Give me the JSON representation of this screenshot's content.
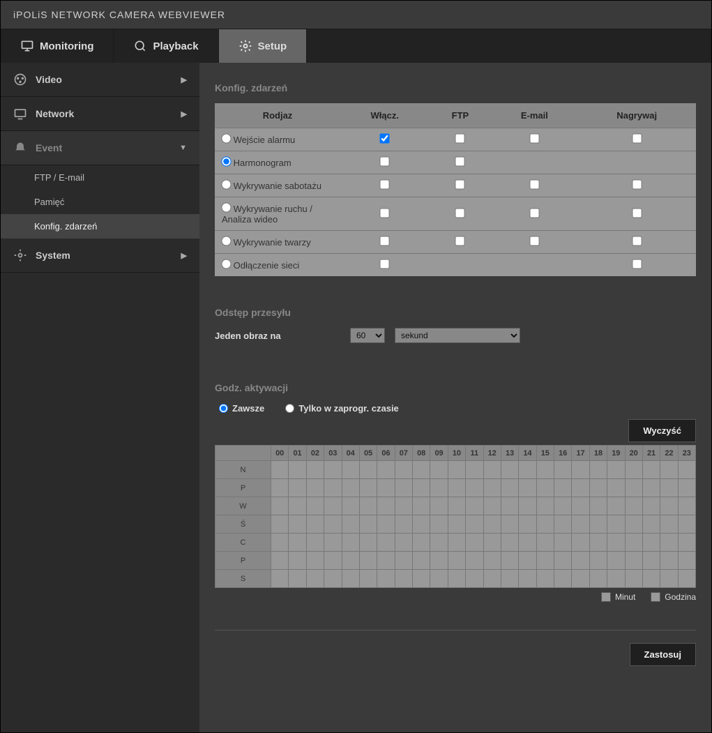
{
  "header": {
    "brand_prefix": "iPOLiS",
    "brand_rest": "NETWORK CAMERA WEBVIEWER"
  },
  "top_tabs": {
    "monitoring": "Monitoring",
    "playback": "Playback",
    "setup": "Setup"
  },
  "sidebar": {
    "video": "Video",
    "network": "Network",
    "event": "Event",
    "event_items": {
      "ftp_email": "FTP / E-mail",
      "storage": "Pamięć",
      "event_setup": "Konfig. zdarzeń"
    },
    "system": "System"
  },
  "sections": {
    "event_setup": "Konfig. zdarzeń",
    "transfer_interval": "Odstęp przesyłu",
    "activation_time": "Godz. aktywacji"
  },
  "event_table": {
    "headers": {
      "type": "Rodjaz",
      "enable": "Włącz.",
      "ftp": "FTP",
      "email": "E-mail",
      "record": "Nagrywaj"
    },
    "rows": [
      {
        "id": "alarm_in",
        "label": "Wejście alarmu",
        "selected": false,
        "enable": true,
        "ftp": false,
        "email": false,
        "record": false,
        "show_ftp": true,
        "show_email": true,
        "show_record": true
      },
      {
        "id": "schedule",
        "label": "Harmonogram",
        "selected": true,
        "enable": false,
        "ftp": false,
        "email": null,
        "record": null,
        "show_ftp": true,
        "show_email": false,
        "show_record": false
      },
      {
        "id": "tamper",
        "label": "Wykrywanie sabotażu",
        "selected": false,
        "enable": false,
        "ftp": false,
        "email": false,
        "record": false,
        "show_ftp": true,
        "show_email": true,
        "show_record": true
      },
      {
        "id": "motion",
        "label": "Wykrywanie ruchu / Analiza wideo",
        "selected": false,
        "enable": false,
        "ftp": false,
        "email": false,
        "record": false,
        "show_ftp": true,
        "show_email": true,
        "show_record": true
      },
      {
        "id": "face",
        "label": "Wykrywanie twarzy",
        "selected": false,
        "enable": false,
        "ftp": false,
        "email": false,
        "record": false,
        "show_ftp": true,
        "show_email": true,
        "show_record": true
      },
      {
        "id": "net_disc",
        "label": "Odłączenie sieci",
        "selected": false,
        "enable": false,
        "ftp": null,
        "email": null,
        "record": false,
        "show_ftp": false,
        "show_email": false,
        "show_record": true
      }
    ]
  },
  "transfer": {
    "label": "Jeden obraz na",
    "amount_value": "60",
    "unit_value": "sekund"
  },
  "activation": {
    "always": "Zawsze",
    "scheduled": "Tylko w zaprogr. czasie",
    "selected": "always",
    "clear": "Wyczyść",
    "hours": [
      "00",
      "01",
      "02",
      "03",
      "04",
      "05",
      "06",
      "07",
      "08",
      "09",
      "10",
      "11",
      "12",
      "13",
      "14",
      "15",
      "16",
      "17",
      "18",
      "19",
      "20",
      "21",
      "22",
      "23"
    ],
    "days": [
      "N",
      "P",
      "W",
      "Ś",
      "C",
      "P",
      "S"
    ],
    "legend_minute": "Minut",
    "legend_hour": "Godzina"
  },
  "apply": "Zastosuj"
}
